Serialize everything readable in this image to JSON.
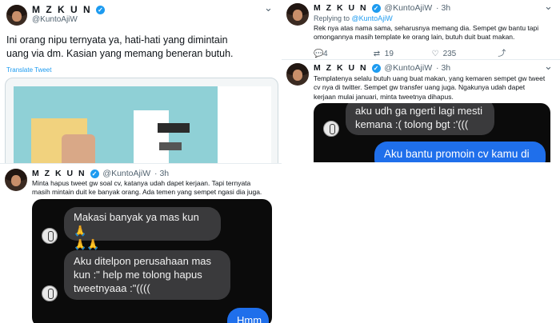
{
  "tweet_main": {
    "name": "M Z K U N",
    "handle": "@KuntoAjiW",
    "text_line1": "Ini orang nipu ternyata ya, hati-hati yang dimintain",
    "text_line2": "uang via dm. Kasian yang memang beneran butuh.",
    "translate": "Translate Tweet"
  },
  "reply1": {
    "name": "M Z K U N",
    "handle": "@KuntoAjiW",
    "time": "· 3h",
    "replying_prefix": "Replying to ",
    "replying_handle": "@KuntoAjiW",
    "text_line1": "Rek nya atas nama sama, seharusnya memang dia. Sempet gw bantu tapi",
    "text_line2": "omongannya masih template ke orang lain, butuh duit buat makan.",
    "reply_count": "4",
    "retweet_count": "19",
    "like_count": "235"
  },
  "reply2": {
    "name": "M Z K U N",
    "handle": "@KuntoAjiW",
    "time": "· 3h",
    "text_line1": "Templatenya selalu butuh uang buat makan, yang kemaren sempet gw tweet",
    "text_line2": "cv nya di twitter. Sempet gw transfer uang juga. Ngakunya udah dapet",
    "text_line3": "kerjaan mulai januari, minta tweetnya dihapus.",
    "chat_msg1_line1": "aku udh ga ngerti lagi mesti",
    "chat_msg1_line2": "kemana :( tolong bgt :'(((",
    "chat_msg2": "Aku bantu promoin cv kamu di"
  },
  "reply3": {
    "name": "M Z K U N",
    "handle": "@KuntoAjiW",
    "time": "· 3h",
    "text_line1": "Minta hapus tweet gw soal cv, katanya udah dapet kerjaan. Tapi ternyata",
    "text_line2": "masih mintain duit ke banyak orang. Ada temen yang sempet ngasi dia juga.",
    "chat_msg1_line1": "Makasi banyak ya mas kun🙏",
    "chat_msg1_line2": "🙏🙏",
    "chat_msg2_line1": "Aku ditelpon perusahaan mas",
    "chat_msg2_line2": "kun :\" help me tolong hapus",
    "chat_msg2_line3": "tweetnyaaa :\"((((",
    "chat_msg3": "Hmm"
  },
  "icons": {
    "verified": "verified-badge-icon",
    "more": "more-icon",
    "reply": "reply-icon",
    "retweet": "retweet-icon",
    "like": "like-icon",
    "share": "share-icon"
  },
  "colors": {
    "accent": "#1d9bf0",
    "chat_bg": "#0b0b0b",
    "bubble_gray": "#3a3a3c",
    "bubble_blue": "#1f6feb"
  }
}
